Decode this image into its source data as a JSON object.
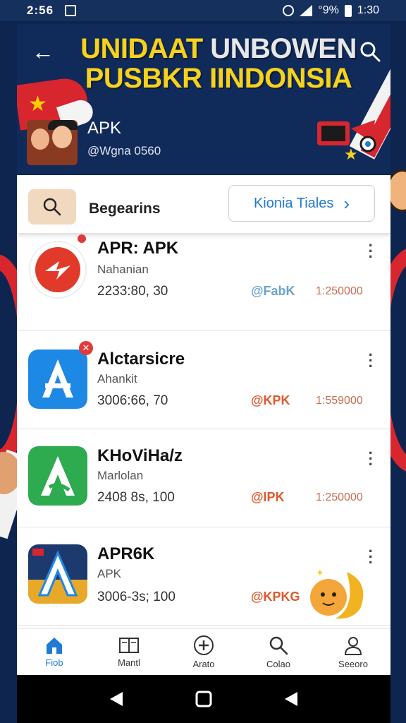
{
  "status_bar": {
    "time": "2:56",
    "battery": "°9%",
    "clock_right": "1:30"
  },
  "header": {
    "title_line1_yellow": "UNIDAAT",
    "title_line1_white": "UNBOWEN",
    "title_line2": "PUSBKR IINDONSIA",
    "account_name": "APK",
    "account_handle": "@Wgna 0560"
  },
  "search": {
    "label": "Begearins",
    "chip_label": "Kionia Tiales"
  },
  "apps": [
    {
      "name": "APR: APK",
      "subtitle": "Nahanian",
      "stat": "2233:80, 30",
      "brand": "@FabK",
      "count": "1:250000",
      "icon_color": "#e23a2a"
    },
    {
      "name": "Alctarsicre",
      "subtitle": "Ahankit",
      "stat": "3006:66, 70",
      "brand": "@KPK",
      "count": "1:559000",
      "icon_color": "#1e88e5"
    },
    {
      "name": "KHoViHa/z",
      "subtitle": "Marlolan",
      "stat": "2408 8s, 100",
      "brand": "@IPK",
      "count": "1:250000",
      "icon_color": "#2eaa4f"
    },
    {
      "name": "APR6K",
      "subtitle": "APK",
      "stat": "3006-3s; 100",
      "brand": "@KPKG",
      "count": "",
      "icon_color": "#1d3a6e"
    }
  ],
  "bottom_nav": [
    {
      "label": "Fiob",
      "icon": "home-icon",
      "active": true
    },
    {
      "label": "Mantl",
      "icon": "book-icon",
      "active": false
    },
    {
      "label": "Arato",
      "icon": "plus-circle-icon",
      "active": false
    },
    {
      "label": "Colao",
      "icon": "search-icon",
      "active": false
    },
    {
      "label": "Seeoro",
      "icon": "person-icon",
      "active": false
    }
  ],
  "colors": {
    "header_bg": "#102a5a",
    "title_yellow": "#f6d21c",
    "accent_blue": "#1f7bd6",
    "flag_red": "#d8262e",
    "brand_orange": "#e0592a"
  }
}
